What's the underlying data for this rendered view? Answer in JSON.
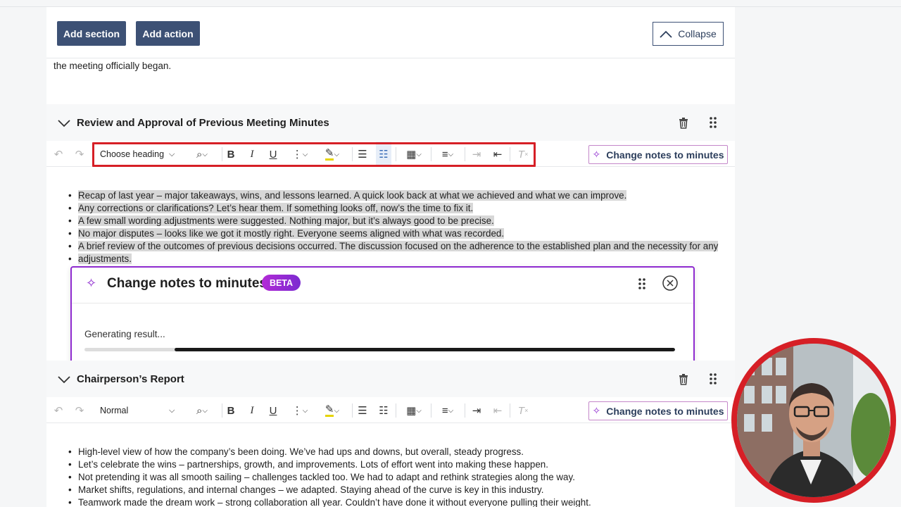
{
  "top_buttons": {
    "add_section": "Add section",
    "add_action": "Add action",
    "collapse": "Collapse"
  },
  "intro_text": "the meeting officially began.",
  "sections": [
    {
      "title": "Review and Approval of Previous Meeting Minutes",
      "heading_select": "Choose heading",
      "change_button": "Change notes to minutes",
      "bullets": [
        "Recap of last year – major takeaways, wins, and lessons learned. A quick look back at what we achieved and what we can improve.",
        "Any corrections or clarifications? Let’s hear them. If something looks off, now’s the time to fix it.",
        "A few small wording adjustments were suggested. Nothing major, but it’s always good to be precise.",
        "No major disputes – looks like we got it mostly right. Everyone seems aligned with what was recorded.",
        "A brief review of the outcomes of previous decisions occurred. The discussion focused on the adherence to the established plan and the necessity for any",
        "adjustments."
      ]
    },
    {
      "title": "Chairperson’s Report",
      "heading_select": "Normal",
      "change_button": "Change notes to minutes",
      "bullets": [
        "High-level view of how the company’s been doing. We’ve had ups and downs, but overall, steady progress.",
        "Let’s celebrate the wins – partnerships, growth, and improvements. Lots of effort went into making these happen.",
        "Not pretending it was all smooth sailing – challenges tackled too. We had to adapt and rethink strategies along the way.",
        "Market shifts, regulations, and internal changes – we adapted. Staying ahead of the curve is key in this industry.",
        "Teamwork made the dream work – strong collaboration all year. Couldn’t have done it without everyone pulling their weight."
      ]
    }
  ],
  "modal": {
    "title": "Change notes to minutes",
    "badge": "BETA",
    "status": "Generating result...",
    "progress": {
      "start": 0.152,
      "end": 1.0
    }
  },
  "colors": {
    "primary": "#3d5175",
    "accent_purple": "#8e2bcf",
    "highlight_red": "#d61f26"
  }
}
